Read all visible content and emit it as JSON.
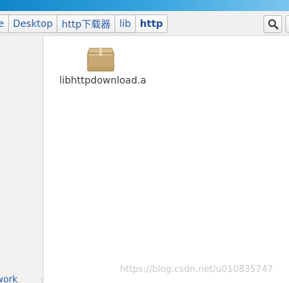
{
  "breadcrumb": {
    "items": [
      {
        "label": "e"
      },
      {
        "label": "Desktop"
      },
      {
        "label": "http下载器"
      },
      {
        "label": "lib"
      },
      {
        "label": "http"
      }
    ]
  },
  "toolbar": {
    "search_icon": "search-icon"
  },
  "sidebar": {
    "partial_label": "work"
  },
  "files": [
    {
      "name": "libhttpdownload.a",
      "icon": "package-icon"
    }
  ],
  "watermark": "https://blog.csdn.net/u010835747",
  "colors": {
    "title_bar": "#1a8fd0",
    "crumb_text": "#2a5aa8",
    "sidebar_bg": "#f2f1f0",
    "package_tan": "#c8a872"
  }
}
